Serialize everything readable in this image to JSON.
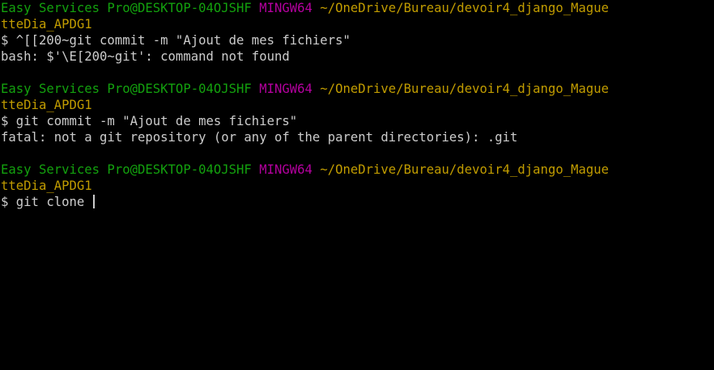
{
  "terminal": {
    "blocks": [
      {
        "prompt": {
          "user_host": "Easy Services Pro@DESKTOP-04OJSHF",
          "system": "MINGW64",
          "path_line1": "~/OneDrive/Bureau/devoir4_django_Mague",
          "path_line2": "tteDia_APDG1"
        },
        "command": "$ ^[[200~git commit -m \"Ajout de mes fichiers\"",
        "output": "bash: $'\\E[200~git': command not found"
      },
      {
        "prompt": {
          "user_host": "Easy Services Pro@DESKTOP-04OJSHF",
          "system": "MINGW64",
          "path_line1": "~/OneDrive/Bureau/devoir4_django_Mague",
          "path_line2": "tteDia_APDG1"
        },
        "command": "$ git commit -m \"Ajout de mes fichiers\"",
        "output": "fatal: not a git repository (or any of the parent directories): .git"
      },
      {
        "prompt": {
          "user_host": "Easy Services Pro@DESKTOP-04OJSHF",
          "system": "MINGW64",
          "path_line1": "~/OneDrive/Bureau/devoir4_django_Mague",
          "path_line2": "tteDia_APDG1"
        },
        "command": "$ git clone "
      }
    ]
  },
  "colors": {
    "background": "#000000",
    "user_host": "#13a10e",
    "system": "#b4009e",
    "path": "#c19c00",
    "text": "#cccccc"
  }
}
